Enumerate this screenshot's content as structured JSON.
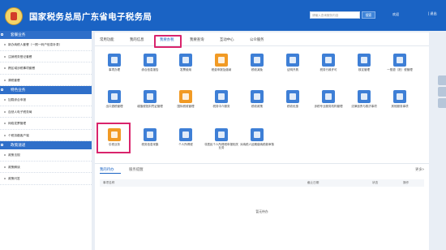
{
  "header": {
    "title": "国家税务总局广东省电子税务局",
    "search_placeholder": "请输入查询服务内容",
    "search_button": "搜索",
    "user": "欢迎",
    "logout": "| 退出"
  },
  "sidebar": {
    "sections": [
      {
        "title": "套餐业务",
        "items": [
          "新办纳税人套餐（一照一码户信息补录）",
          "注销税务登记套餐",
          "跨区域涉税事项套餐",
          "清税套餐"
        ]
      },
      {
        "title": "特色业务",
        "items": [
          "加载综合申报",
          "自然人电子税务局",
          "网络发票管理",
          "个税扣缴客户端"
        ]
      },
      {
        "title": "政策速递",
        "items": [
          "政策法规",
          "政策解读",
          "政策问答"
        ]
      }
    ]
  },
  "tabs": [
    {
      "label": "常用功能"
    },
    {
      "label": "我的信息"
    },
    {
      "label": "我要办税"
    },
    {
      "label": "我要查询"
    },
    {
      "label": "互动中心"
    },
    {
      "label": "公众服务"
    }
  ],
  "functions": [
    {
      "label": "事项办理",
      "icon": "pencil-icon",
      "color": "#3e7fd6"
    },
    {
      "label": "综合信息报告",
      "icon": "document-icon",
      "color": "#3e7fd6"
    },
    {
      "label": "发票使用",
      "icon": "invoice-icon",
      "color": "#3e7fd6"
    },
    {
      "label": "税费申报及缴纳",
      "icon": "tax-declare-icon",
      "color": "#f19a24"
    },
    {
      "label": "税收减免",
      "icon": "tax-reduction-icon",
      "color": "#3e7fd6"
    },
    {
      "label": "证明开具",
      "icon": "certificate-icon",
      "color": "#3e7fd6"
    },
    {
      "label": "税务行政许可",
      "icon": "license-icon",
      "color": "#3e7fd6"
    },
    {
      "label": "核定管理",
      "icon": "check-icon",
      "color": "#3e7fd6"
    },
    {
      "label": "一般退（抵）税管理",
      "icon": "refund-icon",
      "color": "#3e7fd6"
    },
    {
      "label": "出口退税管理",
      "icon": "export-refund-icon",
      "color": "#3e7fd6"
    },
    {
      "label": "增值税抵扣凭证管理",
      "icon": "vat-voucher-icon",
      "color": "#3e7fd6"
    },
    {
      "label": "国际税收管理",
      "icon": "international-tax-icon",
      "color": "#f19a24"
    },
    {
      "label": "税务中介服务",
      "icon": "intermediary-icon",
      "color": "#3e7fd6"
    },
    {
      "label": "税收政策",
      "icon": "policy-icon",
      "color": "#3e7fd6"
    },
    {
      "label": "税收优惠",
      "icon": "preference-icon",
      "color": "#3e7fd6"
    },
    {
      "label": "涉税专业服务机构管理",
      "icon": "agency-icon",
      "color": "#3e7fd6"
    },
    {
      "label": "法律追责与救济事项",
      "icon": "law-icon",
      "color": "#3e7fd6"
    },
    {
      "label": "其他服务事项",
      "icon": "other-icon",
      "color": "#3e7fd6"
    },
    {
      "label": "引税业务",
      "icon": "tax-service-icon",
      "color": "#f19a24"
    },
    {
      "label": "税务信息采集",
      "icon": "info-collect-icon",
      "color": "#3e7fd6"
    },
    {
      "label": "个人所得税",
      "icon": "iit-icon",
      "color": "#3e7fd6"
    },
    {
      "label": "非居民个人所得税申报相关业务",
      "icon": "nonresident-icon",
      "color": "#3e7fd6"
    },
    {
      "label": "对纳税人延期缴纳税款审核",
      "icon": "deferral-icon",
      "color": "#3e7fd6"
    }
  ],
  "panel": {
    "tab_active": "我的待办",
    "tab_other": "服务提醒",
    "more": "更多>",
    "columns": [
      "事项名称",
      "截止日期",
      "状态",
      "操作"
    ],
    "empty": "暂无待办"
  }
}
